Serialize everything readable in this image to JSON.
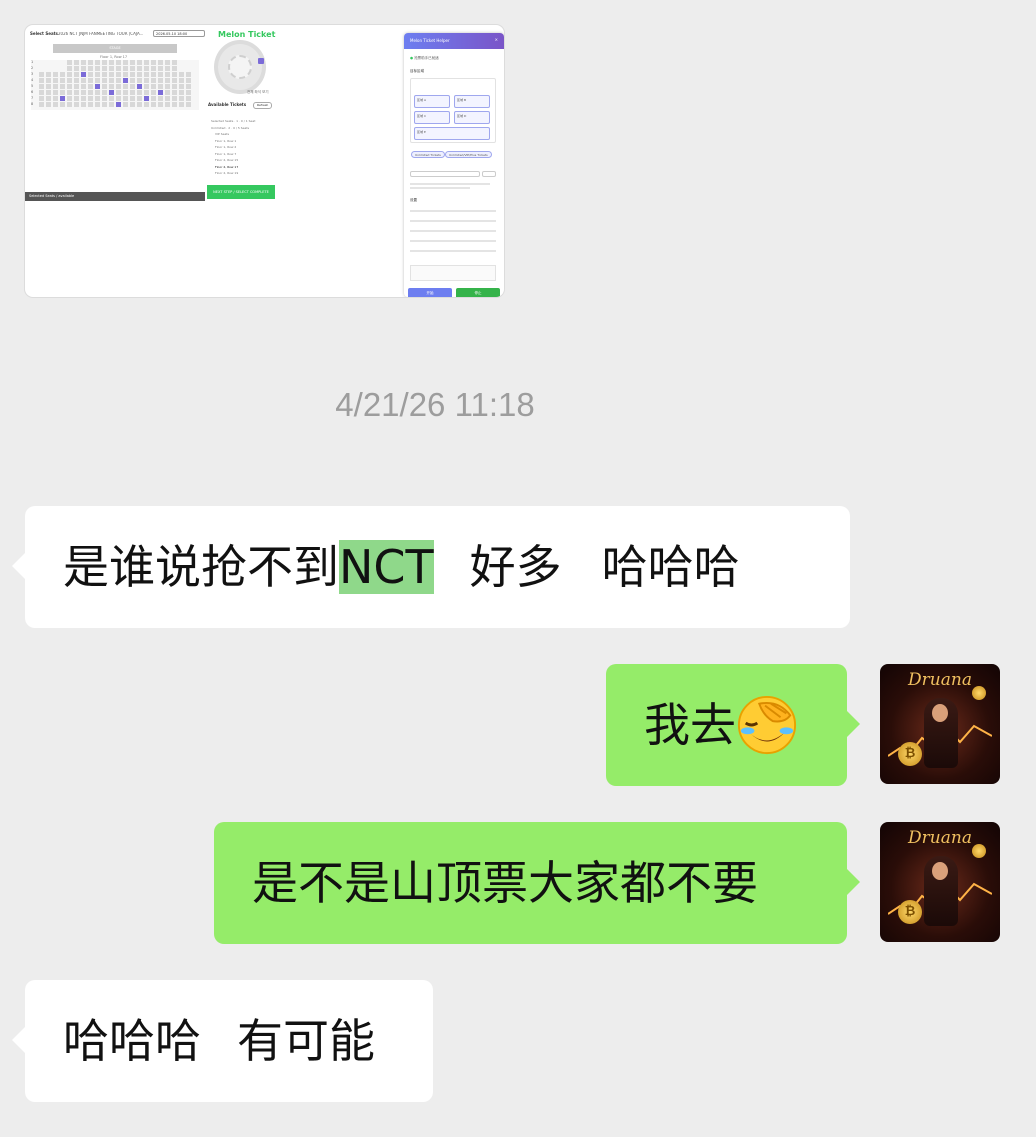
{
  "shared_image": {
    "select_label": "Select Seats",
    "event_title": "2026 NCT JNJM FANMEETING TOUR [CAJA...",
    "date_option": "2026.05.10 18:00",
    "stage_label": "STAGE",
    "floor_label": "Floor 1, Row 17",
    "row_numbers": [
      "1",
      "2",
      "3",
      "4",
      "5",
      "6",
      "7",
      "8"
    ],
    "bottom_bar_label": "Selected Seats / available",
    "brand": "Melon Ticket",
    "map_link": "전체 좌석 보기",
    "available_title": "Available Tickets",
    "refresh_label": "Refresh",
    "ticket_items": [
      "Selected Seats · 1 · 0 / 1 Seat",
      "Unlimited · 2 · 0 / 5 Seats",
      "VIP Seats",
      "Floor 1, Row 1",
      "Floor 1, Row 2",
      "Floor 1, Row 7",
      "Floor 2, Row 15",
      "Floor 2, Row 17",
      "Floor 2, Row 19"
    ],
    "green_button": "NEXT STEP / SELECT COMPLETE",
    "helper_title": "Melon Ticket Helper",
    "helper_close": "×",
    "helper_status": "抢票助手已就绪",
    "helper_section_targets": "目标区域",
    "helper_cards": [
      "区域 A",
      "区域 B",
      "区域 C",
      "区域 D",
      "区域 E"
    ],
    "helper_pills": [
      "Unlimited Tickets",
      "Unlimited/VIP/Plus Tickets"
    ],
    "helper_section_settings": "设置",
    "helper_primary_button": "开始",
    "helper_secondary_button": "停止"
  },
  "timestamp": "4/21/26 11:18",
  "messages": [
    {
      "side": "left",
      "text_before": "是谁说抢不到",
      "highlight": "NCT",
      "text_after": "好多",
      "text_tail": "哈哈哈"
    },
    {
      "side": "right",
      "text": "我去",
      "emoji": "face-palm-crying-emoji"
    },
    {
      "side": "right",
      "text": "是不是山顶票大家都不要"
    },
    {
      "side": "left",
      "text_a": "哈哈哈",
      "text_b": "有可能"
    }
  ],
  "avatar": {
    "caption": "Druana",
    "coin_symbol": "₿"
  },
  "colors": {
    "background": "#ededed",
    "bubble_incoming": "#ffffff",
    "bubble_outgoing": "#95ec69",
    "highlight": "#8fd88a",
    "timestamp": "#9d9d9d"
  }
}
